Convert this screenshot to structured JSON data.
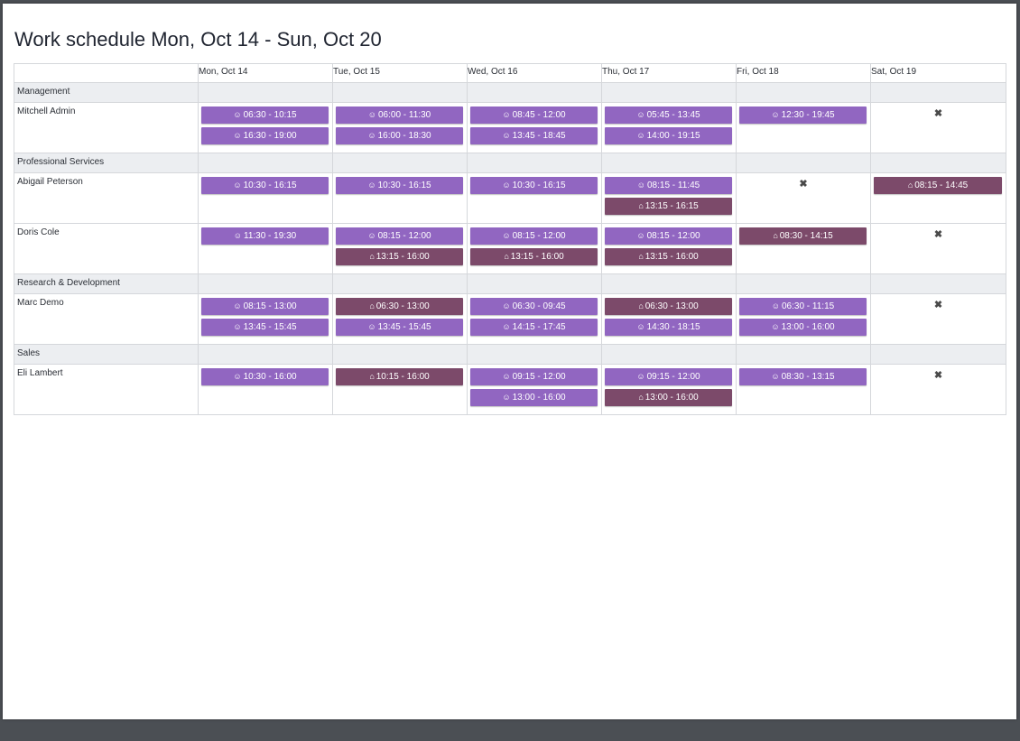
{
  "title": "Work schedule Mon, Oct 14 - Sun, Oct 20",
  "colors": {
    "office": "#9166c1",
    "home": "#7c4a6a"
  },
  "icons": {
    "office": "users-icon",
    "home": "home-icon",
    "absent": "close-icon"
  },
  "days": [
    "Mon, Oct 14",
    "Tue, Oct 15",
    "Wed, Oct 16",
    "Thu, Oct 17",
    "Fri, Oct 18",
    "Sat, Oct 19"
  ],
  "groups": [
    {
      "name": "Management",
      "employees": [
        {
          "name": "Mitchell Admin",
          "days": [
            [
              {
                "time": "06:30 - 10:15",
                "type": "office"
              },
              {
                "time": "16:30 - 19:00",
                "type": "office"
              }
            ],
            [
              {
                "time": "06:00 - 11:30",
                "type": "office"
              },
              {
                "time": "16:00 - 18:30",
                "type": "office"
              }
            ],
            [
              {
                "time": "08:45 - 12:00",
                "type": "office"
              },
              {
                "time": "13:45 - 18:45",
                "type": "office"
              }
            ],
            [
              {
                "time": "05:45 - 13:45",
                "type": "office"
              },
              {
                "time": "14:00 - 19:15",
                "type": "office"
              }
            ],
            [
              {
                "time": "12:30 - 19:45",
                "type": "office"
              }
            ],
            "absent"
          ]
        }
      ]
    },
    {
      "name": "Professional Services",
      "employees": [
        {
          "name": "Abigail Peterson",
          "days": [
            [
              {
                "time": "10:30 - 16:15",
                "type": "office"
              }
            ],
            [
              {
                "time": "10:30 - 16:15",
                "type": "office"
              }
            ],
            [
              {
                "time": "10:30 - 16:15",
                "type": "office"
              }
            ],
            [
              {
                "time": "08:15 - 11:45",
                "type": "office"
              },
              {
                "time": "13:15 - 16:15",
                "type": "home"
              }
            ],
            "absent",
            [
              {
                "time": "08:15 - 14:45",
                "type": "home"
              }
            ]
          ]
        },
        {
          "name": "Doris Cole",
          "days": [
            [
              {
                "time": "11:30 - 19:30",
                "type": "office"
              }
            ],
            [
              {
                "time": "08:15 - 12:00",
                "type": "office"
              },
              {
                "time": "13:15 - 16:00",
                "type": "home"
              }
            ],
            [
              {
                "time": "08:15 - 12:00",
                "type": "office"
              },
              {
                "time": "13:15 - 16:00",
                "type": "home"
              }
            ],
            [
              {
                "time": "08:15 - 12:00",
                "type": "office"
              },
              {
                "time": "13:15 - 16:00",
                "type": "home"
              }
            ],
            [
              {
                "time": "08:30 - 14:15",
                "type": "home"
              }
            ],
            "absent"
          ]
        }
      ]
    },
    {
      "name": "Research & Development",
      "employees": [
        {
          "name": "Marc Demo",
          "days": [
            [
              {
                "time": "08:15 - 13:00",
                "type": "office"
              },
              {
                "time": "13:45 - 15:45",
                "type": "office"
              }
            ],
            [
              {
                "time": "06:30 - 13:00",
                "type": "home"
              },
              {
                "time": "13:45 - 15:45",
                "type": "office"
              }
            ],
            [
              {
                "time": "06:30 - 09:45",
                "type": "office"
              },
              {
                "time": "14:15 - 17:45",
                "type": "office"
              }
            ],
            [
              {
                "time": "06:30 - 13:00",
                "type": "home"
              },
              {
                "time": "14:30 - 18:15",
                "type": "office"
              }
            ],
            [
              {
                "time": "06:30 - 11:15",
                "type": "office"
              },
              {
                "time": "13:00 - 16:00",
                "type": "office"
              }
            ],
            "absent"
          ]
        }
      ]
    },
    {
      "name": "Sales",
      "employees": [
        {
          "name": "Eli Lambert",
          "days": [
            [
              {
                "time": "10:30 - 16:00",
                "type": "office"
              }
            ],
            [
              {
                "time": "10:15 - 16:00",
                "type": "home"
              }
            ],
            [
              {
                "time": "09:15 - 12:00",
                "type": "office"
              },
              {
                "time": "13:00 - 16:00",
                "type": "office"
              }
            ],
            [
              {
                "time": "09:15 - 12:00",
                "type": "office"
              },
              {
                "time": "13:00 - 16:00",
                "type": "home"
              }
            ],
            [
              {
                "time": "08:30 - 13:15",
                "type": "office"
              }
            ],
            "absent"
          ]
        }
      ]
    }
  ]
}
